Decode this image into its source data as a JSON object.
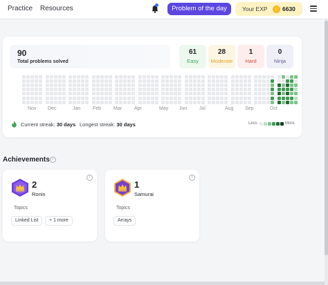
{
  "nav": {
    "links": [
      "Practice",
      "Resources"
    ],
    "potd_label": "Problem of the day",
    "exp_label": "Your EXP",
    "exp_value": "6630"
  },
  "stats": {
    "total": "90",
    "total_label": "Total problems solved",
    "difficulties": [
      {
        "count": "61",
        "label": "Easy",
        "color": "#3ba55c",
        "bg": "#edf8ef"
      },
      {
        "count": "28",
        "label": "Moderate",
        "color": "#e0a52a",
        "bg": "#fdf5e3"
      },
      {
        "count": "1",
        "label": "Hard",
        "color": "#d8473b",
        "bg": "#fdeeed"
      },
      {
        "count": "0",
        "label": "Ninja",
        "color": "#5a5f8c",
        "bg": "#efeff8"
      }
    ],
    "months": [
      "Nov",
      "Dec",
      "Jan",
      "Feb",
      "Mar",
      "Apr",
      "May",
      "Jun",
      "Jul",
      "Aug",
      "Sep",
      "Oct"
    ],
    "current_streak_label": "Current streak:",
    "current_streak": "30 days",
    "longest_streak_label": "Longest streak:",
    "longest_streak": "30 days",
    "legend_less": "Less",
    "legend_more": "More",
    "legend_colors": [
      "#e8e9ec",
      "#b7e0bf",
      "#7cc48a",
      "#3f9b54",
      "#1e6b34",
      "#0f3d1d"
    ]
  },
  "achievements": {
    "title": "Achievements",
    "topics_label": "Topics",
    "cards": [
      {
        "count": "2",
        "rank": "Ronin",
        "badge_color": "#6d3fd6",
        "chips": [
          "Linked List",
          "+ 1 more"
        ]
      },
      {
        "count": "1",
        "rank": "Samurai",
        "badge_color": "#7a3fc9",
        "chips": [
          "Arrays"
        ]
      }
    ]
  }
}
